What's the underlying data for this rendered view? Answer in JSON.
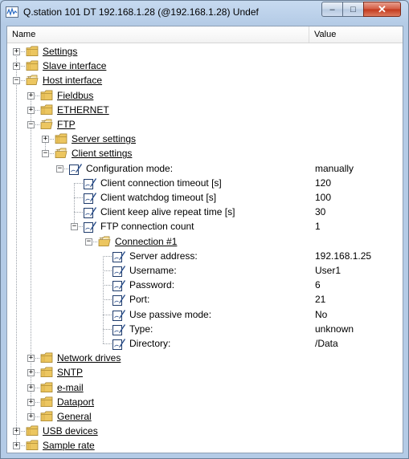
{
  "window": {
    "title": "Q.station 101 DT 192.168.1.28 (@192.168.1.28) Undef",
    "minimize": "–",
    "maximize": "□",
    "close": "✕"
  },
  "header": {
    "name": "Name",
    "value": "Value"
  },
  "tree": [
    {
      "label": "Settings",
      "type": "folder",
      "level": 0,
      "expander": "+",
      "value": ""
    },
    {
      "label": "Slave interface",
      "type": "folder",
      "level": 0,
      "expander": "+",
      "value": ""
    },
    {
      "label": "Host interface",
      "type": "folder",
      "level": 0,
      "expander": "−",
      "value": "",
      "open": true
    },
    {
      "label": "Fieldbus",
      "type": "folder",
      "level": 1,
      "expander": "+",
      "value": ""
    },
    {
      "label": "ETHERNET",
      "type": "folder",
      "level": 1,
      "expander": "+",
      "value": ""
    },
    {
      "label": "FTP",
      "type": "folder",
      "level": 1,
      "expander": "−",
      "value": "",
      "open": true
    },
    {
      "label": "Server settings",
      "type": "folder",
      "level": 2,
      "expander": "+",
      "value": ""
    },
    {
      "label": "Client settings",
      "type": "folder",
      "level": 2,
      "expander": "−",
      "value": "",
      "open": true
    },
    {
      "label": "Configuration mode:",
      "type": "param",
      "level": 3,
      "expander": "−",
      "value": "manually"
    },
    {
      "label": "Client connection timeout [s]",
      "type": "param",
      "level": 4,
      "expander": "",
      "value": "120"
    },
    {
      "label": "Client watchdog timeout [s]",
      "type": "param",
      "level": 4,
      "expander": "",
      "value": "100"
    },
    {
      "label": "Client keep alive repeat time [s]",
      "type": "param",
      "level": 4,
      "expander": "",
      "value": "30"
    },
    {
      "label": "FTP connection count",
      "type": "param",
      "level": 4,
      "expander": "−",
      "value": "1"
    },
    {
      "label": "Connection #1",
      "type": "folder",
      "level": 5,
      "expander": "−",
      "value": "",
      "open": true
    },
    {
      "label": "Server address:",
      "type": "param",
      "level": 6,
      "expander": "",
      "value": "192.168.1.25"
    },
    {
      "label": "Username:",
      "type": "param",
      "level": 6,
      "expander": "",
      "value": "User1"
    },
    {
      "label": "Password:",
      "type": "param",
      "level": 6,
      "expander": "",
      "value": "6"
    },
    {
      "label": "Port:",
      "type": "param",
      "level": 6,
      "expander": "",
      "value": "21"
    },
    {
      "label": "Use passive mode:",
      "type": "param",
      "level": 6,
      "expander": "",
      "value": "No"
    },
    {
      "label": "Type:",
      "type": "param",
      "level": 6,
      "expander": "",
      "value": "unknown"
    },
    {
      "label": "Directory:",
      "type": "param",
      "level": 6,
      "expander": "",
      "value": "/Data"
    },
    {
      "label": "Network drives",
      "type": "folder",
      "level": 1,
      "expander": "+",
      "value": ""
    },
    {
      "label": "SNTP",
      "type": "folder",
      "level": 1,
      "expander": "+",
      "value": ""
    },
    {
      "label": "e-mail",
      "type": "folder",
      "level": 1,
      "expander": "+",
      "value": ""
    },
    {
      "label": "Dataport",
      "type": "folder",
      "level": 1,
      "expander": "+",
      "value": ""
    },
    {
      "label": "General",
      "type": "folder",
      "level": 1,
      "expander": "+",
      "value": ""
    },
    {
      "label": "USB devices",
      "type": "folder",
      "level": 0,
      "expander": "+",
      "value": ""
    },
    {
      "label": "Sample rate",
      "type": "folder",
      "level": 0,
      "expander": "+",
      "value": ""
    }
  ],
  "colors": {
    "folder": "#e8c468",
    "folder_edge": "#a3822e",
    "param": "#2b4f8c"
  }
}
